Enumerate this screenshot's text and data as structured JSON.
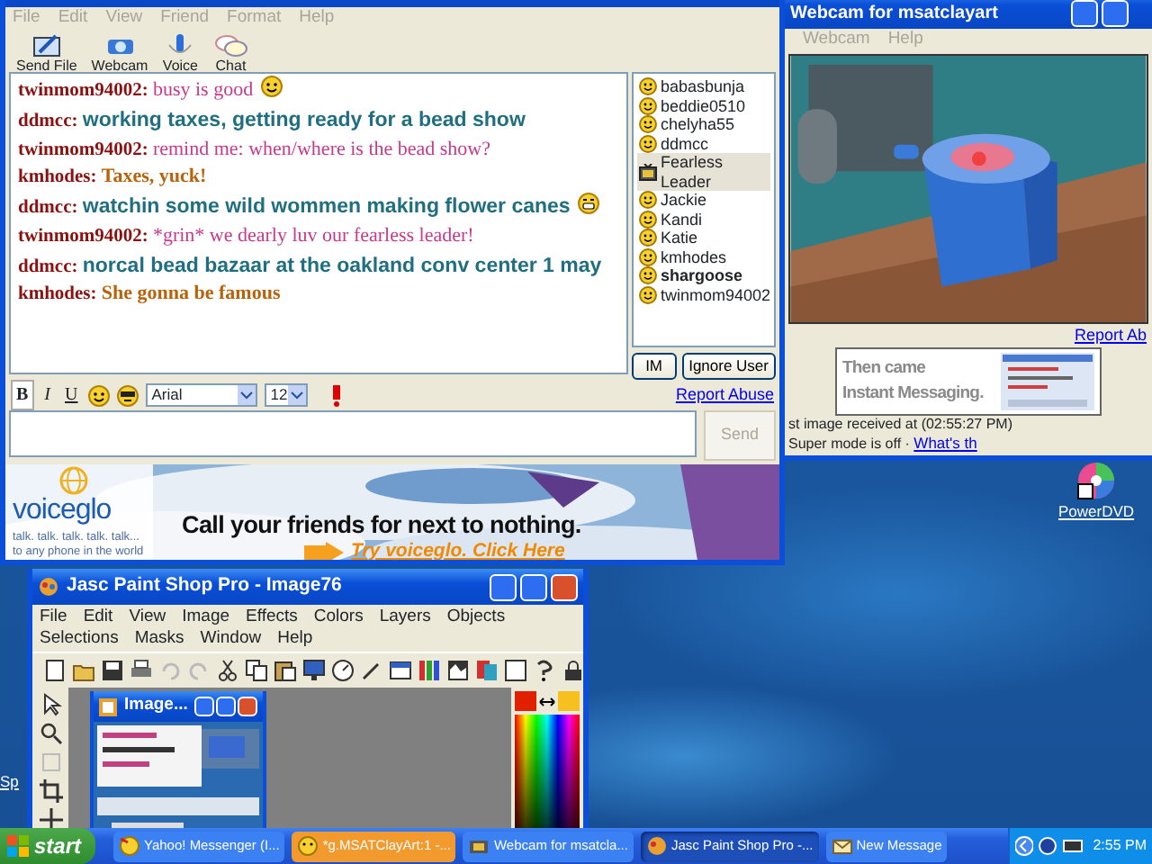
{
  "chat_window": {
    "menu": [
      "File",
      "Edit",
      "View",
      "Friend",
      "Format",
      "Help"
    ],
    "toolbar": [
      {
        "label": "Send File",
        "kind": "file"
      },
      {
        "label": "Webcam",
        "kind": "webcam"
      },
      {
        "label": "Voice",
        "kind": "voice"
      },
      {
        "label": "Chat",
        "kind": "chat"
      }
    ],
    "messages": [
      {
        "user": "twinmom94002:",
        "text": "busy is good",
        "kind": "small",
        "color": "#c8388c",
        "emoticon": true
      },
      {
        "user": "ddmcc:",
        "text": "working taxes, getting ready for a bead show",
        "kind": "large",
        "color": "#1f6f80"
      },
      {
        "user": "twinmom94002:",
        "text": "remind me: when/where is the bead show?",
        "kind": "small",
        "color": "#c8388c"
      },
      {
        "user": "kmhodes:",
        "text": "Taxes, yuck!",
        "kind": "small",
        "color": "#b8620a"
      },
      {
        "user": "ddmcc:",
        "text": "watchin some wild wommen making flower canes",
        "kind": "large",
        "color": "#1f6f80",
        "emoticon": true
      },
      {
        "user": "twinmom94002:",
        "text": "*grin* we dearly luv our fearless leader!",
        "kind": "small",
        "color": "#c8388c"
      },
      {
        "user": "ddmcc:",
        "text": "norcal bead bazaar at the oakland conv center 1 may",
        "kind": "large",
        "color": "#1f6f80"
      },
      {
        "user": "kmhodes:",
        "text": "She gonna be famous",
        "kind": "small",
        "color": "#b8620a"
      }
    ],
    "users": [
      {
        "name": "babasbunja",
        "selected": false,
        "bold": false,
        "webcam": false
      },
      {
        "name": "beddie0510",
        "selected": false,
        "bold": false,
        "webcam": false
      },
      {
        "name": "chelyha55",
        "selected": false,
        "bold": false,
        "webcam": false
      },
      {
        "name": "ddmcc",
        "selected": false,
        "bold": false,
        "webcam": false
      },
      {
        "name": "Fearless Leader",
        "selected": true,
        "bold": false,
        "webcam": true
      },
      {
        "name": "Jackie",
        "selected": false,
        "bold": false,
        "webcam": false
      },
      {
        "name": "Kandi",
        "selected": false,
        "bold": false,
        "webcam": false
      },
      {
        "name": "Katie",
        "selected": false,
        "bold": false,
        "webcam": false
      },
      {
        "name": "kmhodes",
        "selected": false,
        "bold": false,
        "webcam": false
      },
      {
        "name": "shargoose",
        "selected": false,
        "bold": true,
        "webcam": false
      },
      {
        "name": "twinmom94002",
        "selected": false,
        "bold": false,
        "webcam": false
      }
    ],
    "buttons": [
      "IM",
      "Ignore User"
    ],
    "format_bar": {
      "bold": "B",
      "italic": "I",
      "underline": "U",
      "font": "Arial",
      "size": "12",
      "report": "Report Abuse"
    },
    "send": {
      "label": "Send",
      "disabled": true
    },
    "ad": {
      "logo": "voiceglo",
      "tagline_1": "talk. talk. talk. talk. talk...",
      "tagline_2": "to any phone in the world",
      "headline": "Call your friends for next to nothing.",
      "link": "Try voiceglo. Click Here"
    }
  },
  "webcam_window": {
    "title": "Webcam for msatclayart",
    "menu": [
      "Webcam",
      "Help"
    ],
    "report": "Report Ab",
    "ad": {
      "line_1": "Then came",
      "line_2": "Instant Messaging."
    },
    "status": "st image received at (02:55:27 PM)",
    "mode": "Super mode is off ·",
    "mode_link": "What's th"
  },
  "paint_window": {
    "title": "Jasc Paint Shop Pro - Image76",
    "menu": [
      "File",
      "Edit",
      "View",
      "Image",
      "Effects",
      "Colors",
      "Layers",
      "Objects",
      "Selections",
      "Masks",
      "Window",
      "Help"
    ],
    "image_window": {
      "title": "Image..."
    }
  },
  "desktop_icons": [
    {
      "label": "PowerDVD"
    },
    {
      "label": "Sp"
    }
  ],
  "taskbar": {
    "start": "start",
    "tasks": [
      {
        "label": "Yahoo! Messenger (I...",
        "kind": "messenger",
        "selected": false,
        "flashing": false
      },
      {
        "label": "*g.MSATClayArt:1 -...",
        "kind": "chat",
        "selected": false,
        "flashing": true
      },
      {
        "label": "Webcam for msatcla...",
        "kind": "webcam",
        "selected": false,
        "flashing": false
      },
      {
        "label": "Jasc Paint Shop Pro -...",
        "kind": "paint",
        "selected": true,
        "flashing": false
      },
      {
        "label": "New Message",
        "kind": "mail",
        "selected": false,
        "flashing": false
      }
    ],
    "clock": "2:55 PM"
  }
}
